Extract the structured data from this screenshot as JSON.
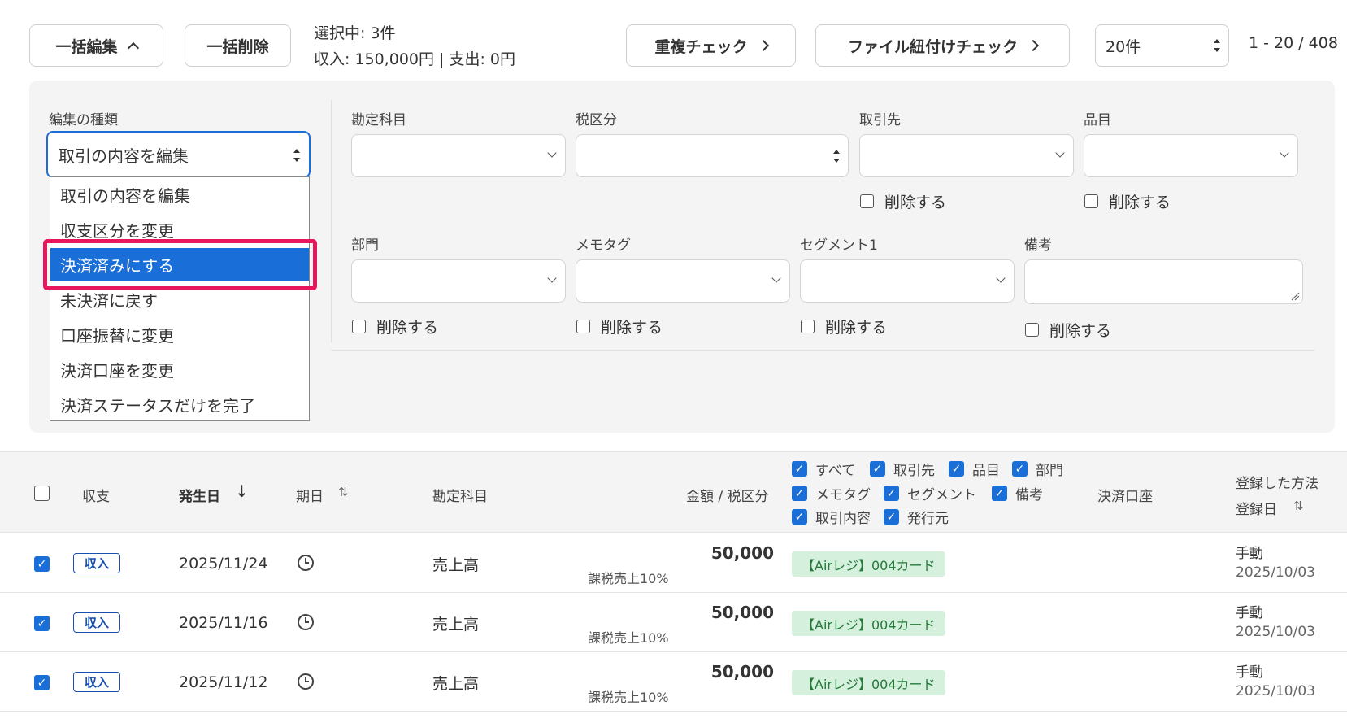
{
  "toolbar": {
    "bulk_edit_label": "一括編集",
    "bulk_delete_label": "一括削除",
    "selected_text": "選択中: 3件",
    "summary_text": "収入: 150,000円 | 支出: 0円",
    "duplicate_check_label": "重複チェック",
    "file_link_check_label": "ファイル紐付けチェック",
    "per_page_value": "20件",
    "pagination_text": "1 - 20 / 408"
  },
  "edit_panel": {
    "kind_label": "編集の種類",
    "kind_value": "取引の内容を編集",
    "kind_options": [
      "取引の内容を編集",
      "収支区分を変更",
      "決済済みにする",
      "未決済に戻す",
      "口座振替に変更",
      "決済口座を変更",
      "決済ステータスだけを完了"
    ],
    "highlighted_option_index": 2,
    "fields": {
      "account_label": "勘定科目",
      "tax_label": "税区分",
      "partner_label": "取引先",
      "item_label": "品目",
      "department_label": "部門",
      "memo_tag_label": "メモタグ",
      "segment_label": "セグメント1",
      "note_label": "備考"
    },
    "delete_label": "削除する"
  },
  "table": {
    "headers": {
      "type": "収支",
      "date": "発生日",
      "due": "期日",
      "account": "勘定科目",
      "amount": "金額 / 税区分",
      "payment_account": "決済口座",
      "register_method": "登録した方法",
      "register_date": "登録日"
    },
    "column_options": [
      "すべて",
      "取引先",
      "品目",
      "部門",
      "メモタグ",
      "セグメント",
      "備考",
      "取引内容",
      "発行元"
    ],
    "rows": [
      {
        "type": "収入",
        "date": "2025/11/24",
        "account": "売上高",
        "amount": "50,000",
        "tax": "課税売上10%",
        "tag": "【Airレジ】004カード",
        "method": "手動",
        "reg_date": "2025/10/03"
      },
      {
        "type": "収入",
        "date": "2025/11/16",
        "account": "売上高",
        "amount": "50,000",
        "tax": "課税売上10%",
        "tag": "【Airレジ】004カード",
        "method": "手動",
        "reg_date": "2025/10/03"
      },
      {
        "type": "収入",
        "date": "2025/11/12",
        "account": "売上高",
        "amount": "50,000",
        "tax": "課税売上10%",
        "tag": "【Airレジ】004カード",
        "method": "手動",
        "reg_date": "2025/10/03"
      }
    ]
  },
  "colors": {
    "accent": "#1a6ed8",
    "highlight_border": "#e8175d",
    "tag_bg": "#d5f0dc",
    "tag_text": "#247a3a",
    "panel_bg": "#f4f4f5"
  }
}
